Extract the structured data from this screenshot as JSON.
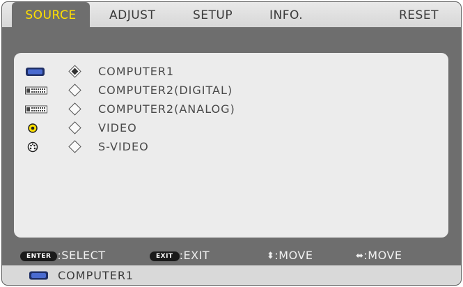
{
  "menu": {
    "tabs": [
      {
        "id": "source",
        "label": "SOURCE",
        "active": true
      },
      {
        "id": "adjust",
        "label": "ADJUST",
        "active": false
      },
      {
        "id": "setup",
        "label": "SETUP",
        "active": false
      },
      {
        "id": "info",
        "label": "INFO.",
        "active": false
      },
      {
        "id": "reset",
        "label": "RESET",
        "active": false
      }
    ]
  },
  "sources": [
    {
      "label": "COMPUTER1",
      "icon": "monitor-icon",
      "selected": true
    },
    {
      "label": "COMPUTER2(DIGITAL)",
      "icon": "dvi-connector-icon",
      "selected": false
    },
    {
      "label": "COMPUTER2(ANALOG)",
      "icon": "dvi-connector-icon",
      "selected": false
    },
    {
      "label": "VIDEO",
      "icon": "rca-video-icon",
      "selected": false
    },
    {
      "label": "S-VIDEO",
      "icon": "s-video-icon",
      "selected": false
    }
  ],
  "guide": {
    "enter_key": "ENTER",
    "enter_action": ":SELECT",
    "exit_key": "EXIT",
    "exit_action": ":EXIT",
    "updown_symbol": "⬍",
    "updown_action": ":MOVE",
    "leftright_symbol": "⬌",
    "leftright_action": ":MOVE"
  },
  "status": {
    "icon": "monitor-icon",
    "current_source": "COMPUTER1"
  },
  "colors": {
    "active_tab_text": "#ffe000",
    "frame": "#6e6e6e",
    "panel": "#ececec",
    "video_icon": "#ffe000"
  }
}
